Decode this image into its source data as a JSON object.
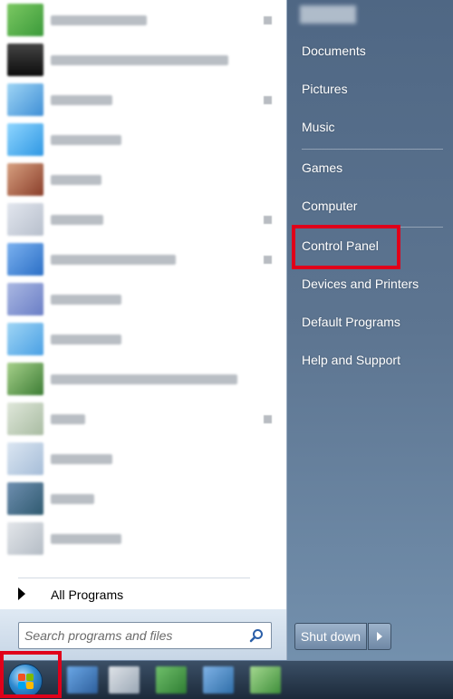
{
  "all_programs_label": "All Programs",
  "search": {
    "placeholder": "Search programs and files",
    "value": ""
  },
  "right_links": [
    {
      "label": "Documents"
    },
    {
      "label": "Pictures"
    },
    {
      "label": "Music"
    },
    {
      "label": "Games"
    },
    {
      "label": "Computer"
    },
    {
      "label": "Control Panel",
      "highlighted": true
    },
    {
      "label": "Devices and Printers"
    },
    {
      "label": "Default Programs"
    },
    {
      "label": "Help and Support"
    }
  ],
  "shutdown": {
    "label": "Shut down"
  },
  "icons": {
    "search": "search-icon",
    "shutdown_arrow": "chevron-right-icon",
    "all_programs_arrow": "triangle-right-icon",
    "start": "windows-logo-icon"
  },
  "colors": {
    "highlight": "#e0001a",
    "right_pane": "#5d7591",
    "left_pane": "#ffffff"
  }
}
